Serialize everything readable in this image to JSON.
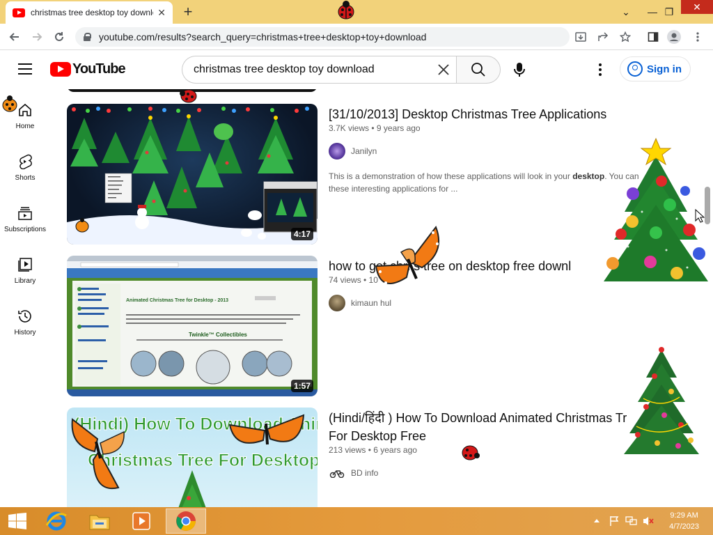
{
  "browser": {
    "tab_title": "christmas tree desktop toy download",
    "tab_close": "✕",
    "new_tab": "+",
    "url": "youtube.com/results?search_query=christmas+tree+desktop+toy+download",
    "win_min": "—",
    "win_max": "❐",
    "win_close": "✕",
    "win_chevron": "⌄"
  },
  "youtube": {
    "logo_text": "YouTube",
    "search_value": "christmas tree desktop toy download",
    "signin_label": "Sign in"
  },
  "sidebar": {
    "items": [
      {
        "label": "Home",
        "icon": "home-icon"
      },
      {
        "label": "Shorts",
        "icon": "shorts-icon"
      },
      {
        "label": "Subscriptions",
        "icon": "subscriptions-icon"
      },
      {
        "label": "Library",
        "icon": "library-icon"
      },
      {
        "label": "History",
        "icon": "history-icon"
      }
    ]
  },
  "results": [
    {
      "title": "[31/10/2013] Desktop Christmas Tree Applications",
      "meta": "3.7K views • 9 years ago",
      "channel": "Janilyn",
      "desc_pre": "This is a demonstration of how these applications will look in your ",
      "desc_bold": "desktop",
      "desc_post": ". You can",
      "desc_line2": "these interesting applications for ...",
      "duration": "4:17"
    },
    {
      "title": "how to get chri         s tree on desktop free downl",
      "meta": "74 views • 10",
      "channel": "kimaun hul",
      "duration": "1:57",
      "thumb_heading": "Animated Christmas Tree for Desktop - 2013",
      "thumb_brand": "Twinkle™ Collectibles"
    },
    {
      "title_line1": "(Hindi/हिंदी ) How To Download Animated Christmas Tr",
      "title_line2": "For Desktop Free",
      "meta": "213 views • 6 years ago",
      "channel": "BD info",
      "thumb_text_1": "(Hindi) How To Download Animated",
      "thumb_text_2": "Christmas Tree For Desktop Free"
    }
  ],
  "taskbar": {
    "time": "9:29 AM",
    "date": "4/7/2023"
  },
  "colors": {
    "accent": "#065fd4",
    "brand_red": "#ff0000",
    "taskbar": "#e49a3c"
  }
}
